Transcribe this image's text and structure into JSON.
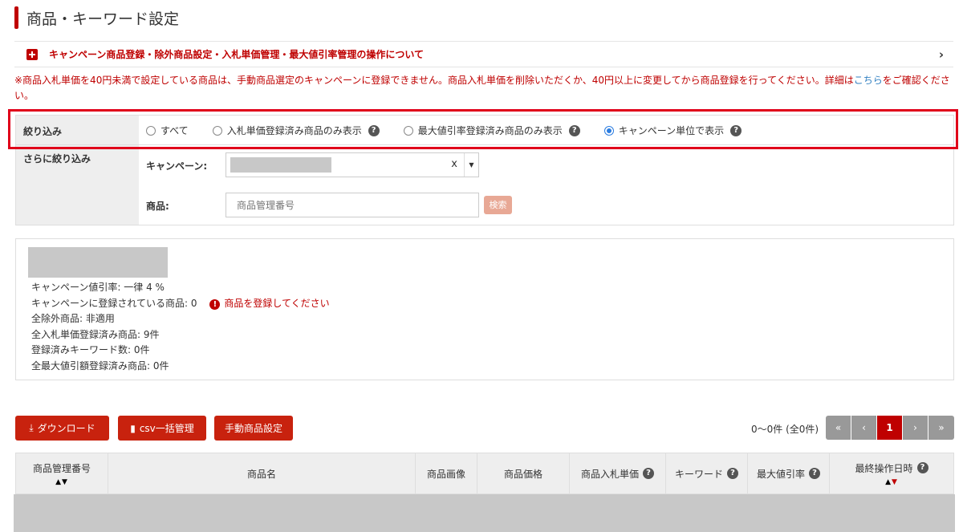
{
  "page": {
    "title": "商品・キーワード設定"
  },
  "notice": {
    "text": "キャンペーン商品登録・除外商品設定・入札単価管理・最大値引率管理の操作について"
  },
  "warning": {
    "text": "※商品入札単価を40円未満で設定している商品は、手動商品選定のキャンペーンに登録できません。商品入札単価を削除いただくか、40円以上に変更してから商品登録を行ってください。詳細は",
    "link": "こちら",
    "tail": "をご確認ください。"
  },
  "filter": {
    "label": "絞り込み",
    "options": [
      {
        "label": "すべて",
        "selected": false,
        "help": false
      },
      {
        "label": "入札単価登録済み商品のみ表示",
        "selected": false,
        "help": true
      },
      {
        "label": "最大値引率登録済み商品のみ表示",
        "selected": false,
        "help": true
      },
      {
        "label": "キャンペーン単位で表示",
        "selected": true,
        "help": true
      }
    ]
  },
  "further_filter": {
    "label": "さらに絞り込み",
    "campaign_label": "キャンペーン:",
    "campaign_clear": "x",
    "product_label": "商品:",
    "product_placeholder": "商品管理番号",
    "search_label": "検索"
  },
  "info": {
    "discount": "キャンペーン値引率: 一律 4 %",
    "registered": "キャンペーンに登録されている商品: 0",
    "registered_alert": "商品を登録してください",
    "excluded": "全除外商品: 非適用",
    "bid_registered": "全入札単価登録済み商品: 9件",
    "keywords": "登録済みキーワード数: 0件",
    "max_discount": "全最大値引額登録済み商品: 0件"
  },
  "buttons": {
    "download": "ダウンロード",
    "csv": "csv一括管理",
    "manual": "手動商品設定"
  },
  "pager": {
    "count": "0〜0件 (全0件)",
    "first": "«",
    "prev": "‹",
    "current": "1",
    "next": "›",
    "last": "»"
  },
  "table": {
    "headers": {
      "id": "商品管理番号",
      "name": "商品名",
      "image": "商品画像",
      "price": "商品価格",
      "bid": "商品入札単価",
      "keyword": "キーワード",
      "max_discount": "最大値引率",
      "last_op": "最終操作日時"
    }
  },
  "colors": {
    "accent": "#bf0000",
    "highlight": "#e0001a",
    "link": "#2f7fc1"
  }
}
